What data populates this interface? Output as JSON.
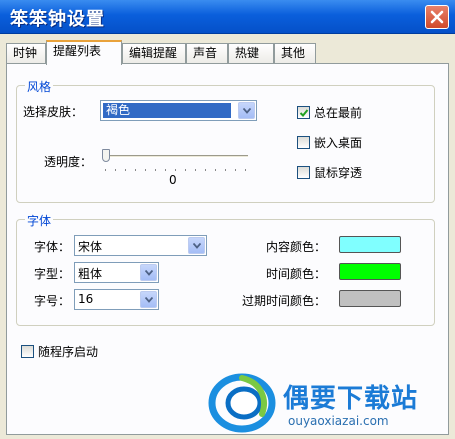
{
  "window": {
    "title": "笨笨钟设置"
  },
  "tabs": [
    {
      "label": "时钟"
    },
    {
      "label": "提醒列表"
    },
    {
      "label": "编辑提醒"
    },
    {
      "label": "声音"
    },
    {
      "label": "热键"
    },
    {
      "label": "其他"
    }
  ],
  "style_group": {
    "title": "风格",
    "skin_label": "选择皮肤：",
    "skin_value": "褐色",
    "opacity_label": "透明度：",
    "opacity_value": "0",
    "always_on_top": {
      "label": "总在最前",
      "checked": true
    },
    "embed_desktop": {
      "label": "嵌入桌面",
      "checked": false
    },
    "mouse_through": {
      "label": "鼠标穿透",
      "checked": false
    }
  },
  "font_group": {
    "title": "字体",
    "font_label": "字体：",
    "font_value": "宋体",
    "style_label": "字型：",
    "style_value": "粗体",
    "size_label": "字号：",
    "size_value": "16",
    "content_color_label": "内容颜色：",
    "time_color_label": "时间颜色：",
    "expired_color_label": "过期时间颜色：",
    "colors": {
      "content": "#80ffff",
      "time": "#00ff00",
      "expired": "#c0c0c0"
    }
  },
  "startup": {
    "label": "随程序启动",
    "checked": false
  },
  "watermark": {
    "name": "偶要下载站",
    "url": "ouyaoxiazai.com"
  }
}
